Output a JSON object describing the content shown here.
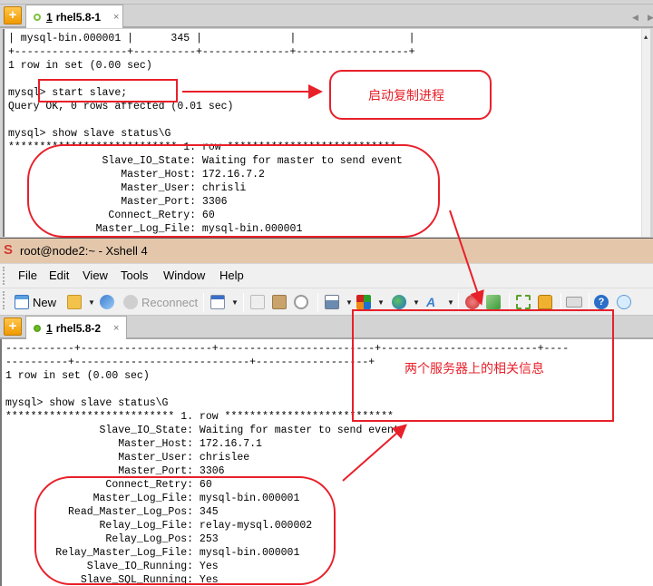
{
  "window1": {
    "tab": {
      "number": "1",
      "label": "rhel5.8-1",
      "close": "×"
    },
    "terminal_lines": [
      "| mysql-bin.000001 |      345 |              |                  |",
      "+------------------+----------+--------------+------------------+",
      "1 row in set (0.00 sec)",
      "",
      "mysql> start slave;",
      "Query OK, 0 rows affected (0.01 sec)",
      "",
      "mysql> show slave status\\G",
      "*************************** 1. row ***************************",
      "               Slave_IO_State: Waiting for master to send event",
      "                  Master_Host: 172.16.7.2",
      "                  Master_User: chrisli",
      "                  Master_Port: 3306",
      "                Connect_Retry: 60",
      "              Master_Log_File: mysql-bin.000001"
    ]
  },
  "window2": {
    "title": "root@node2:~ - Xshell 4",
    "menu": [
      "File",
      "Edit",
      "View",
      "Tools",
      "Window",
      "Help"
    ],
    "toolbar": {
      "new_label": "New",
      "reconnect_label": "Reconnect"
    },
    "tab": {
      "number": "1",
      "label": "rhel5.8-2",
      "close": "×"
    },
    "terminal_lines": [
      "-----------+---------------------+-------------------------+-------------------------+----",
      "----------+----------------------------+------------------+",
      "1 row in set (0.00 sec)",
      "",
      "mysql> show slave status\\G",
      "*************************** 1. row ***************************",
      "               Slave_IO_State: Waiting for master to send event",
      "                  Master_Host: 172.16.7.1",
      "                  Master_User: chrislee",
      "                  Master_Port: 3306",
      "                Connect_Retry: 60",
      "              Master_Log_File: mysql-bin.000001",
      "          Read_Master_Log_Pos: 345",
      "               Relay_Log_File: relay-mysql.000002",
      "                Relay_Log_Pos: 253",
      "        Relay_Master_Log_File: mysql-bin.000001",
      "             Slave_IO_Running: Yes",
      "            Slave_SQL_Running: Yes"
    ]
  },
  "annotations": {
    "start_replication": "启动复制进程",
    "related_info": "两个服务器上的相关信息"
  },
  "colors": {
    "annotation_red": "#e8202a",
    "titlebar_bg": "#e4c7ab",
    "session_green": "#6cbf2a"
  }
}
